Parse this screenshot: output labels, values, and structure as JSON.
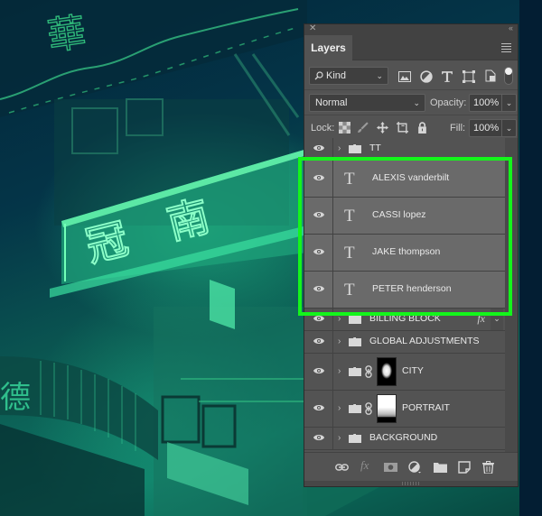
{
  "panel": {
    "tab_label": "Layers",
    "close_icon": "close-x-icon",
    "collapse_icon": "double-chevron-left-icon",
    "menu_icon": "hamburger-menu-icon"
  },
  "filter": {
    "kind_label": "Kind",
    "kind_icon": "search-icon",
    "filter_icons": [
      "image-filter-icon",
      "adjustment-filter-icon",
      "type-filter-icon",
      "shape-filter-icon",
      "smart-object-filter-icon"
    ],
    "toggle_state": "on"
  },
  "blend": {
    "mode": "Normal",
    "opacity_label": "Opacity:",
    "opacity_value": "100%"
  },
  "lock": {
    "label": "Lock:",
    "icons": [
      "lock-transparent-pixels-icon",
      "lock-image-pixels-icon",
      "lock-position-icon",
      "lock-artboard-icon",
      "lock-all-icon"
    ],
    "fill_label": "Fill:",
    "fill_value": "100%"
  },
  "layers": [
    {
      "name": "TT",
      "type": "group",
      "visible": true,
      "selected": false
    },
    {
      "name": "ALEXIS vanderbilt",
      "type": "text",
      "visible": true,
      "selected": true
    },
    {
      "name": "CASSI lopez",
      "type": "text",
      "visible": true,
      "selected": true
    },
    {
      "name": "JAKE thompson",
      "type": "text",
      "visible": true,
      "selected": true
    },
    {
      "name": "PETER henderson",
      "type": "text",
      "visible": true,
      "selected": true
    },
    {
      "name": "BILLING BLOCK",
      "type": "group",
      "visible": true,
      "selected": false,
      "effects": "fx"
    },
    {
      "name": "GLOBAL ADJUSTMENTS",
      "type": "group",
      "visible": true,
      "selected": false
    },
    {
      "name": "CITY",
      "type": "group-masked",
      "visible": true,
      "selected": false
    },
    {
      "name": "PORTRAIT",
      "type": "group-masked",
      "visible": true,
      "selected": false
    },
    {
      "name": "BACKGROUND",
      "type": "group",
      "visible": true,
      "selected": false
    }
  ],
  "bottom_toolbar": [
    "link-layers-icon",
    "fx-icon",
    "add-mask-icon",
    "adjustment-layer-icon",
    "new-group-icon",
    "new-layer-icon",
    "delete-icon"
  ],
  "highlight_color": "#14f51b",
  "background_scene": {
    "signs": [
      "華",
      "冠",
      "南",
      "德"
    ]
  }
}
